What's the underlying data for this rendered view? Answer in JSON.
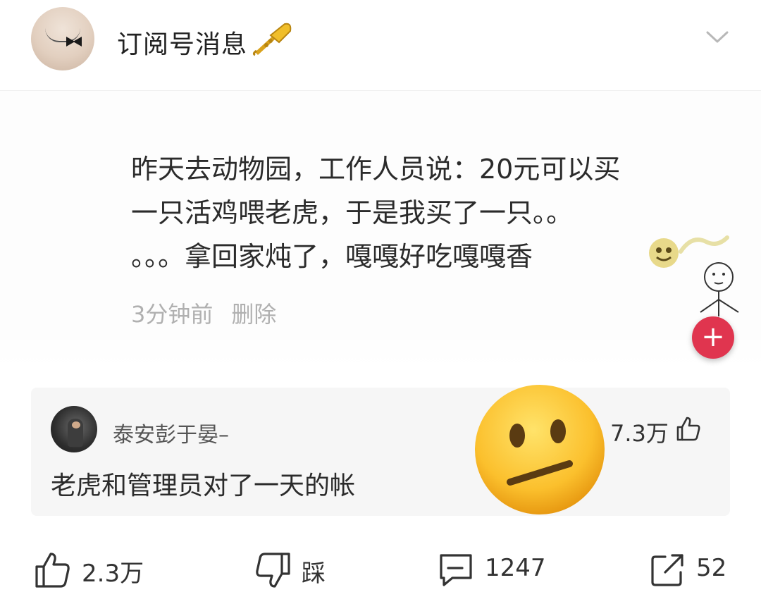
{
  "header": {
    "title": "订阅号消息",
    "trumpet_icon": "trumpet-emoji",
    "collapse_icon": "chevron-down-icon"
  },
  "post": {
    "text_lines": [
      "昨天去动物园，工作人员说：20元可以买",
      "一只活鸡喂老虎，于是我买了一只。。",
      "。。。拿回家炖了，嘎嘎好吃嘎嘎香"
    ],
    "time": "3分钟前",
    "delete_label": "删除",
    "add_button_label": "+"
  },
  "comment": {
    "username": "泰安彭于晏–",
    "text": "老虎和管理员对了一天的帐",
    "likes": "7.3万"
  },
  "actions": {
    "like_count": "2.3万",
    "dislike_label": "踩",
    "comment_count": "1247",
    "share_count": "52"
  },
  "colors": {
    "accent_red": "#e0354f",
    "meta_gray": "#b0b0b0",
    "comment_bg": "#f6f6f6"
  }
}
